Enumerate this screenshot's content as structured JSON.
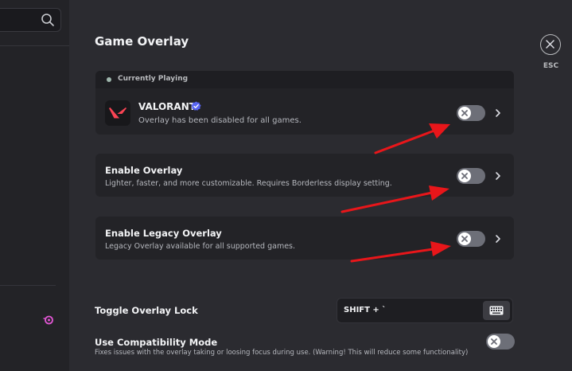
{
  "header": {
    "title": "Game Overlay",
    "close_label": "ESC"
  },
  "current_game": {
    "section_label": "Currently Playing",
    "name": "VALORANT",
    "status": "Overlay has been disabled for all games.",
    "overlay_enabled": false
  },
  "settings": {
    "enable_overlay": {
      "title": "Enable Overlay",
      "description": "Lighter, faster, and more customizable. Requires Borderless display setting.",
      "enabled": false
    },
    "legacy_overlay": {
      "title": "Enable Legacy Overlay",
      "description": "Legacy Overlay available for all supported games.",
      "enabled": false
    },
    "overlay_lock": {
      "title": "Toggle Overlay Lock",
      "keybind": "SHIFT + `"
    },
    "compatibility": {
      "title": "Use Compatibility Mode",
      "description": "Fixes issues with the overlay taking or loosing focus during use. (Warning! This will reduce some functionality)",
      "enabled": false
    }
  },
  "colors": {
    "background": "#2b2b30",
    "card": "#232327",
    "toggle_off": "#6d6f78",
    "annotation_arrow": "#e8161a",
    "verified": "#5865f2",
    "valorant": "#fa4454"
  }
}
